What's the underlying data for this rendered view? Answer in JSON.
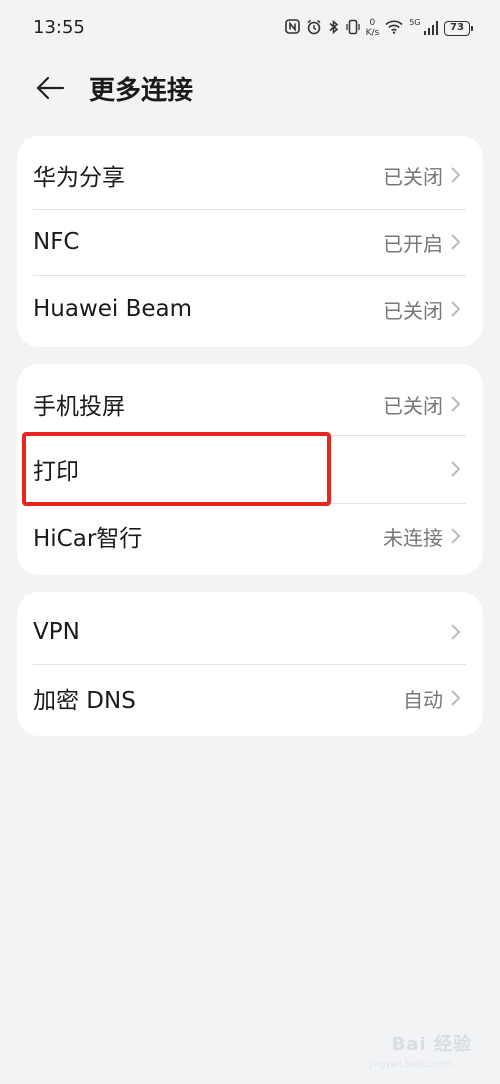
{
  "status_bar": {
    "time": "13:55",
    "net_speed_value": "0",
    "net_speed_unit": "K/s",
    "network": "5G",
    "battery": "73",
    "icons": [
      "nfc-icon",
      "alarm-icon",
      "bluetooth-icon",
      "vibrate-icon",
      "wifi-icon",
      "signal-icon",
      "battery-icon"
    ]
  },
  "header": {
    "title": "更多连接",
    "back_icon": "back-arrow-icon"
  },
  "groups": [
    {
      "items": [
        {
          "label": "华为分享",
          "value": "已关闭"
        },
        {
          "label": "NFC",
          "value": "已开启"
        },
        {
          "label": "Huawei Beam",
          "value": "已关闭"
        }
      ]
    },
    {
      "items": [
        {
          "label": "手机投屏",
          "value": "已关闭"
        },
        {
          "label": "打印",
          "value": ""
        },
        {
          "label": "HiCar智行",
          "value": "未连接"
        }
      ]
    },
    {
      "items": [
        {
          "label": "VPN",
          "value": ""
        },
        {
          "label": "加密 DNS",
          "value": "自动"
        }
      ]
    }
  ],
  "highlight_color": "#e8261f",
  "watermark": {
    "text": "Bai 经验",
    "sub": "jingyan.baidu.com"
  }
}
